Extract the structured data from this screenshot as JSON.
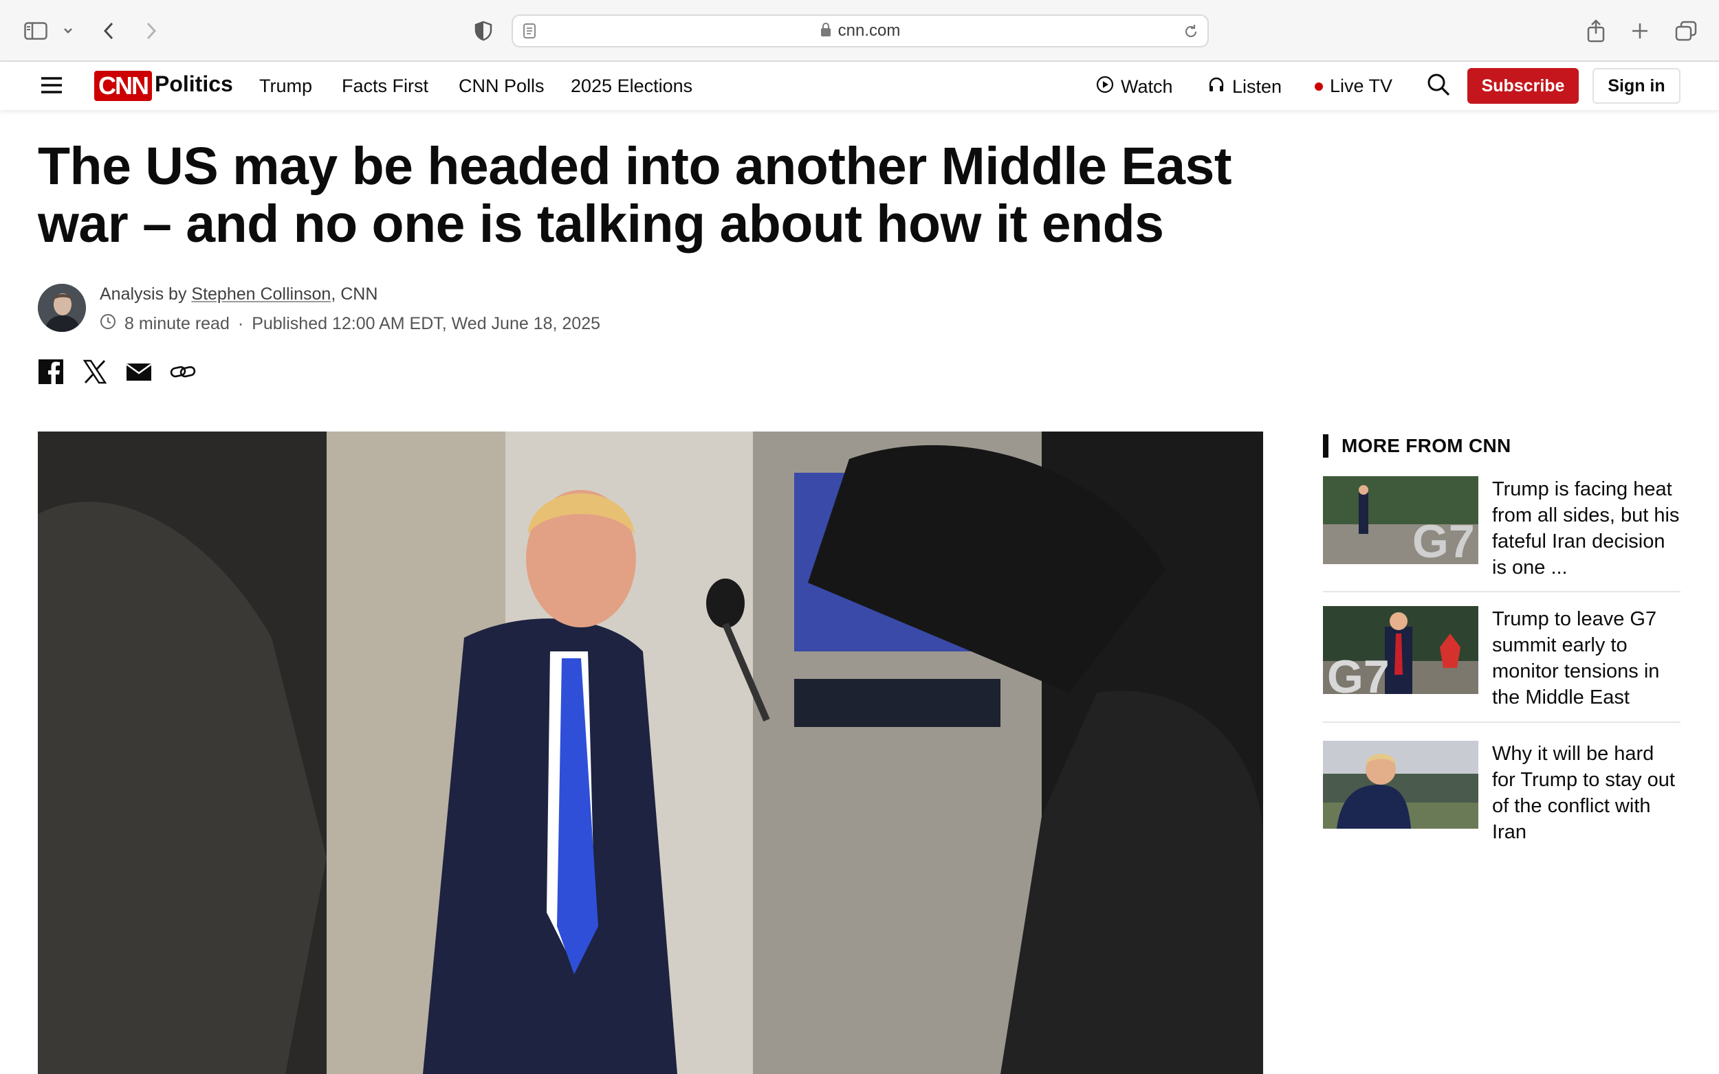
{
  "browser": {
    "url": "cnn.com"
  },
  "nav": {
    "brand": "CNN",
    "section": "Politics",
    "links": [
      "Trump",
      "Facts First",
      "CNN Polls",
      "2025 Elections"
    ],
    "watch": "Watch",
    "listen": "Listen",
    "live_tv": "Live TV",
    "subscribe": "Subscribe",
    "sign_in": "Sign in",
    "colors": {
      "brand_red": "#cc0000",
      "subscribe_red": "#c4161c",
      "live_dot": "#cc0000"
    }
  },
  "article": {
    "headline": "The US may be headed into another Middle East war – and no one is talking about how it ends",
    "byline_prefix": "Analysis by ",
    "author": "Stephen Collinson",
    "byline_suffix": ", CNN",
    "read_time": "8 minute read",
    "separator": "·",
    "published": "Published 12:00 AM EDT, Wed June 18, 2025",
    "share_icons": [
      "facebook-icon",
      "x-icon",
      "email-icon",
      "link-icon"
    ]
  },
  "sidebar": {
    "title": "MORE FROM CNN",
    "items": [
      {
        "headline": "Trump is facing heat from all sides, but his fateful Iran decision is one ...",
        "thumb_label": "G7"
      },
      {
        "headline": "Trump to leave G7 summit early to monitor tensions in the Middle East",
        "thumb_label": "G7"
      },
      {
        "headline": "Why it will be hard for Trump to stay out of the conflict with Iran",
        "thumb_label": ""
      }
    ]
  }
}
